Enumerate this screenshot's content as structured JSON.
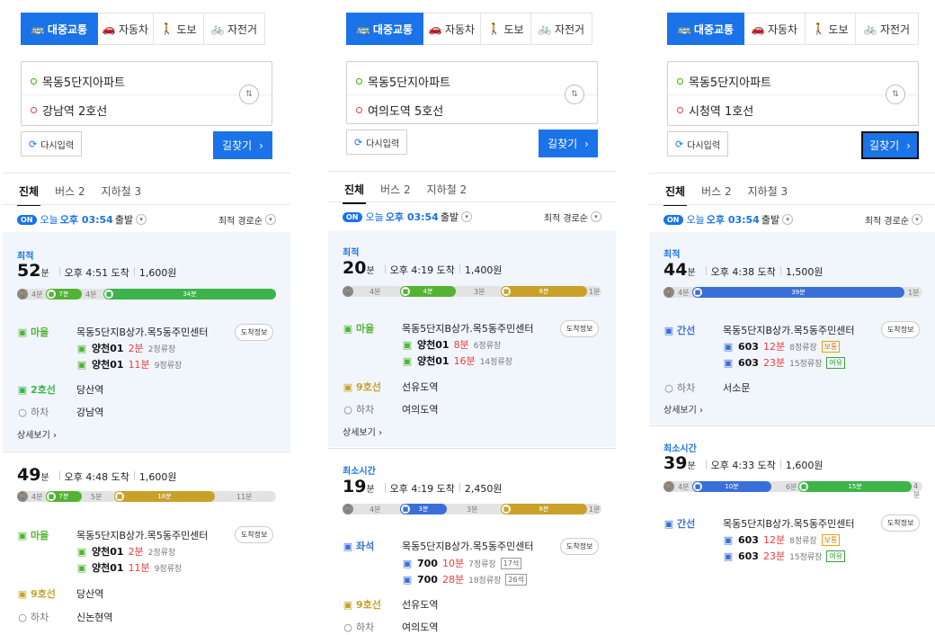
{
  "common": {
    "modes": [
      "대중교통",
      "자동차",
      "도보",
      "자전거"
    ],
    "reset_label": "다시입력",
    "search_label": "길찾기",
    "departure_on": "ON",
    "departure_prefix": "오늘",
    "departure_time": "오후 03:54",
    "departure_suffix": "출발",
    "sort_label": "최적 경로순",
    "arrival_info_label": "도착정보",
    "detail_label": "상세보기",
    "unit_min": "분",
    "tab_all": "진체"
  },
  "panels": [
    {
      "origin": "목동5단지아파트",
      "destination": "강남역 2호선",
      "tabs": [
        "진체",
        "버스 2",
        "지하철 3"
      ],
      "routes": [
        {
          "tag": "최적",
          "minutes": "52",
          "arrival": "오후 4:51 도착",
          "fare": "1,600원",
          "bar_segments": [
            {
              "kind": "walk",
              "label": "4분"
            },
            {
              "kind": "bus",
              "color": "#53b332",
              "label": "7분"
            },
            {
              "kind": "gap",
              "label": "4분"
            },
            {
              "kind": "subway",
              "color": "#3cb44a",
              "label": "34분"
            }
          ],
          "steps": [
            {
              "type": "마을",
              "color": "#53b332",
              "name": "목동5단지B상가.목5동주민센터",
              "buses": [
                {
                  "num": "양천01",
                  "min": "2분",
                  "stops": "2정류장"
                },
                {
                  "num": "양천01",
                  "min": "11분",
                  "stops": "9정류장"
                }
              ]
            },
            {
              "type": "2호선",
              "color": "#3cb44a",
              "name": "당산역"
            },
            {
              "type": "하차",
              "color": "#777",
              "name": "강남역"
            }
          ]
        },
        {
          "tag": "",
          "minutes": "49",
          "arrival": "오후 4:48 도착",
          "fare": "1,600원",
          "bar_segments": [
            {
              "kind": "walk",
              "label": "4분"
            },
            {
              "kind": "bus",
              "color": "#53b332",
              "label": "7분"
            },
            {
              "kind": "gap",
              "label": "5분"
            },
            {
              "kind": "subway",
              "color": "#c9a12a",
              "label": "18분"
            },
            {
              "kind": "gap",
              "label": "11분"
            }
          ],
          "steps": [
            {
              "type": "마을",
              "color": "#53b332",
              "name": "목동5단지B상가.목5동주민센터",
              "buses": [
                {
                  "num": "양천01",
                  "min": "2분",
                  "stops": "2정류장"
                },
                {
                  "num": "양천01",
                  "min": "11분",
                  "stops": "9정류장"
                }
              ]
            },
            {
              "type": "9호선",
              "color": "#c9a12a",
              "name": "당산역"
            },
            {
              "type": "하차",
              "color": "#777",
              "name": "신논현역"
            }
          ]
        }
      ]
    },
    {
      "origin": "목동5단지아파트",
      "destination": "여의도역 5호선",
      "tabs": [
        "진체",
        "버스 2",
        "지하철 2"
      ],
      "routes": [
        {
          "tag": "최적",
          "minutes": "20",
          "arrival": "오후 4:19 도착",
          "fare": "1,400원",
          "bar_segments": [
            {
              "kind": "walk",
              "label": ""
            },
            {
              "kind": "gap",
              "label": "4분"
            },
            {
              "kind": "bus",
              "color": "#53b332",
              "label": "4분"
            },
            {
              "kind": "gap",
              "label": "3분"
            },
            {
              "kind": "subway",
              "color": "#c9a12a",
              "label": "8분"
            },
            {
              "kind": "gap",
              "label": "1분"
            }
          ],
          "steps": [
            {
              "type": "마을",
              "color": "#53b332",
              "name": "목동5단지B상가.목5동주민센터",
              "buses": [
                {
                  "num": "양천01",
                  "min": "8분",
                  "stops": "6정류장"
                },
                {
                  "num": "양천01",
                  "min": "16분",
                  "stops": "14정류장"
                }
              ]
            },
            {
              "type": "9호선",
              "color": "#c9a12a",
              "name": "선유도역"
            },
            {
              "type": "하차",
              "color": "#777",
              "name": "여의도역"
            }
          ]
        },
        {
          "tag": "최소시간",
          "minutes": "19",
          "arrival": "오후 4:19 도착",
          "fare": "2,450원",
          "bar_segments": [
            {
              "kind": "walk",
              "label": ""
            },
            {
              "kind": "gap",
              "label": "4분"
            },
            {
              "kind": "bus",
              "color": "#3a6fd8",
              "label": "3분"
            },
            {
              "kind": "gap",
              "label": "3분"
            },
            {
              "kind": "subway",
              "color": "#c9a12a",
              "label": "8분"
            },
            {
              "kind": "gap",
              "label": "1분"
            }
          ],
          "steps": [
            {
              "type": "좌석",
              "color": "#3a6fd8",
              "name": "목동5단지B상가.목5동주민센터",
              "buses": [
                {
                  "num": "700",
                  "min": "10분",
                  "stops": "7정류장",
                  "badge": "17석"
                },
                {
                  "num": "700",
                  "min": "28분",
                  "stops": "18정류장",
                  "badge": "26석"
                }
              ]
            },
            {
              "type": "9호선",
              "color": "#c9a12a",
              "name": "선유도역"
            },
            {
              "type": "하차",
              "color": "#777",
              "name": "여의도역"
            }
          ]
        }
      ]
    },
    {
      "origin": "목동5단지아파트",
      "destination": "시청역 1호선",
      "tabs": [
        "진체",
        "버스 2",
        "지하철 3"
      ],
      "routes": [
        {
          "tag": "최적",
          "minutes": "44",
          "arrival": "오후 4:38 도착",
          "fare": "1,500원",
          "bar_segments": [
            {
              "kind": "walk",
              "label": "4분"
            },
            {
              "kind": "bus",
              "color": "#3a6fd8",
              "label": "39분"
            },
            {
              "kind": "gap",
              "label": "1분"
            }
          ],
          "steps": [
            {
              "type": "간선",
              "color": "#3a6fd8",
              "name": "목동5단지B상가.목5동주민센터",
              "buses": [
                {
                  "num": "603",
                  "min": "12분",
                  "stops": "8정류장",
                  "badge": "보통",
                  "badge_color": "orange"
                },
                {
                  "num": "603",
                  "min": "23분",
                  "stops": "15정류장",
                  "badge": "여유",
                  "badge_color": "green"
                }
              ]
            },
            {
              "type": "하차",
              "color": "#777",
              "name": "서소문"
            }
          ]
        },
        {
          "tag": "최소시간",
          "minutes": "39",
          "arrival": "오후 4:33 도착",
          "fare": "1,600원",
          "bar_segments": [
            {
              "kind": "walk",
              "label": "4분"
            },
            {
              "kind": "bus",
              "color": "#3a6fd8",
              "label": "10분"
            },
            {
              "kind": "gap",
              "label": "6분"
            },
            {
              "kind": "subway",
              "color": "#3cb44a",
              "label": "15분"
            },
            {
              "kind": "gap",
              "label": "4분"
            }
          ],
          "steps": [
            {
              "type": "간선",
              "color": "#3a6fd8",
              "name": "목동5단지B상가.목5동주민센터",
              "buses": [
                {
                  "num": "603",
                  "min": "12분",
                  "stops": "8정류장",
                  "badge": "보통",
                  "badge_color": "orange"
                },
                {
                  "num": "603",
                  "min": "23분",
                  "stops": "15정류장",
                  "badge": "여유",
                  "badge_color": "green"
                }
              ]
            }
          ]
        }
      ]
    }
  ]
}
